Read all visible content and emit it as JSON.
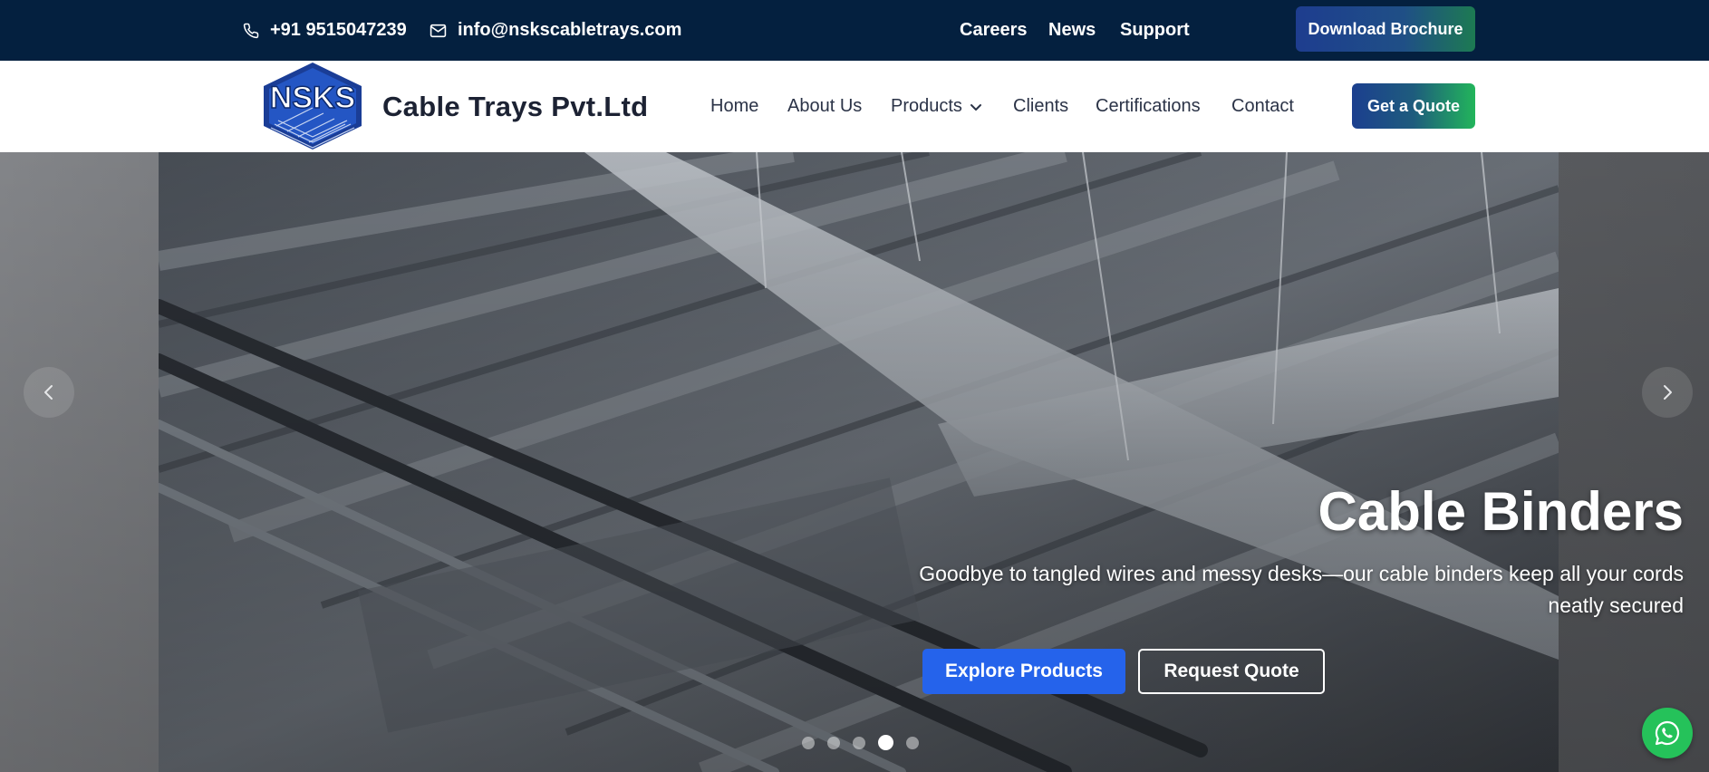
{
  "topbar": {
    "phone": "+91 9515047239",
    "email": "info@nskscabletrays.com",
    "links": [
      "Careers",
      "News",
      "Support"
    ],
    "brochure_label": "Download Brochure"
  },
  "navbar": {
    "logo_text": "NSKS",
    "brand": "Cable Trays Pvt.Ltd",
    "links": {
      "home": "Home",
      "about": "About Us",
      "products": "Products",
      "clients": "Clients",
      "certifications": "Certifications",
      "contact": "Contact"
    },
    "quote_label": "Get a Quote"
  },
  "hero": {
    "title": "Cable Binders",
    "subtitle": "Goodbye to tangled wires and messy desks—our cable binders keep all your cords neatly secured",
    "primary_cta": "Explore Products",
    "secondary_cta": "Request Quote",
    "slide_count": 5,
    "active_slide": 4
  },
  "icons": {
    "phone": "phone-icon",
    "email": "mail-icon",
    "dropdown": "chevron-down-icon",
    "prev": "chevron-left-icon",
    "next": "chevron-right-icon",
    "whatsapp": "whatsapp-icon"
  },
  "colors": {
    "topbar_bg": "#04203f",
    "primary_blue": "#2563eb",
    "accent_green": "#22b55b",
    "whatsapp_green": "#25c25a"
  }
}
